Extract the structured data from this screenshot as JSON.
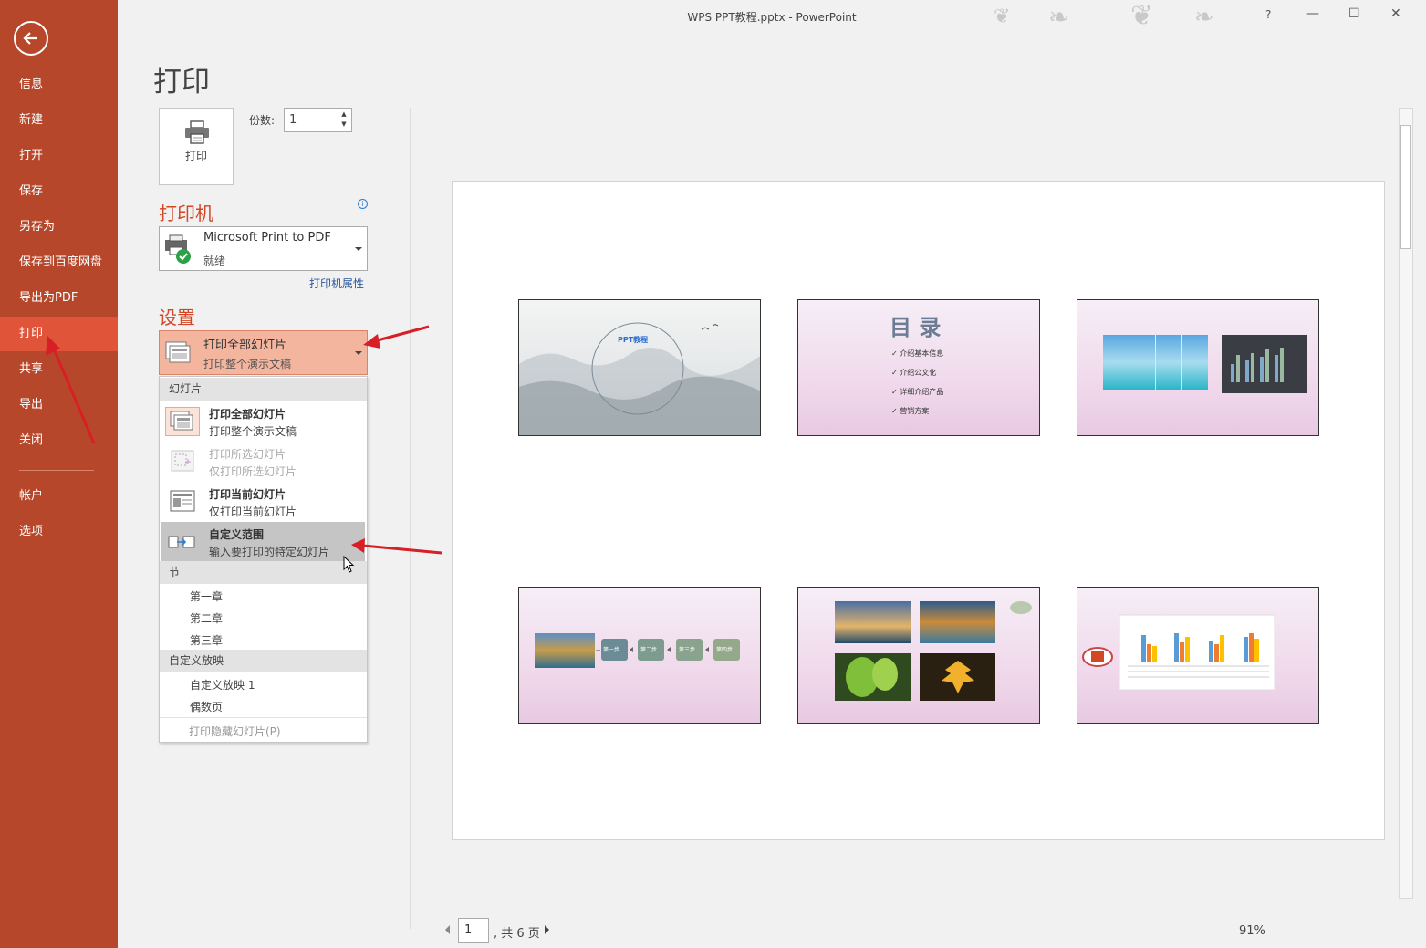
{
  "window": {
    "title": "WPS PPT教程.pptx - PowerPoint",
    "help": "?"
  },
  "sidebar": {
    "items": [
      {
        "label": "信息"
      },
      {
        "label": "新建"
      },
      {
        "label": "打开"
      },
      {
        "label": "保存"
      },
      {
        "label": "另存为"
      },
      {
        "label": "保存到百度网盘"
      },
      {
        "label": "导出为PDF"
      },
      {
        "label": "打印"
      },
      {
        "label": "共享"
      },
      {
        "label": "导出"
      },
      {
        "label": "关闭"
      },
      {
        "label": "帐户"
      },
      {
        "label": "选项"
      }
    ],
    "active": "打印"
  },
  "main": {
    "title": "打印",
    "print_button": "打印",
    "copies_label": "份数:",
    "copies_value": "1",
    "printer_section": "打印机",
    "printer_name": "Microsoft Print to PDF",
    "printer_status": "就绪",
    "printer_props": "打印机属性",
    "settings_section": "设置",
    "slides_select_title": "打印全部幻灯片",
    "slides_select_sub": "打印整个演示文稿"
  },
  "dropdown": {
    "header_slides": "幻灯片",
    "options": [
      {
        "title": "打印全部幻灯片",
        "sub": "打印整个演示文稿"
      },
      {
        "title": "打印所选幻灯片",
        "sub": "仅打印所选幻灯片"
      },
      {
        "title": "打印当前幻灯片",
        "sub": "仅打印当前幻灯片"
      },
      {
        "title": "自定义范围",
        "sub": "输入要打印的特定幻灯片"
      }
    ],
    "header_sections": "节",
    "sections": [
      "第一章",
      "第二章",
      "第三章"
    ],
    "header_custom": "自定义放映",
    "custom_shows": [
      "自定义放映 1",
      "偶数页"
    ],
    "footer": "打印隐藏幻灯片(P)"
  },
  "preview": {
    "slide1_title": "PPT教程",
    "slide2_title": "目 录",
    "slide2_items": [
      "介绍基本信息",
      "介绍公文化",
      "详细介绍产品",
      "营销方案"
    ],
    "slide4_steps": [
      "第一步",
      "第二步",
      "第三步",
      "第四步"
    ]
  },
  "pager": {
    "current": "1",
    "total": ", 共 6 页"
  },
  "zoom": "91%",
  "colors": {
    "sidebar": "#b7472a",
    "active": "#e0543a",
    "accent": "#d24726",
    "link": "#2b579a"
  }
}
